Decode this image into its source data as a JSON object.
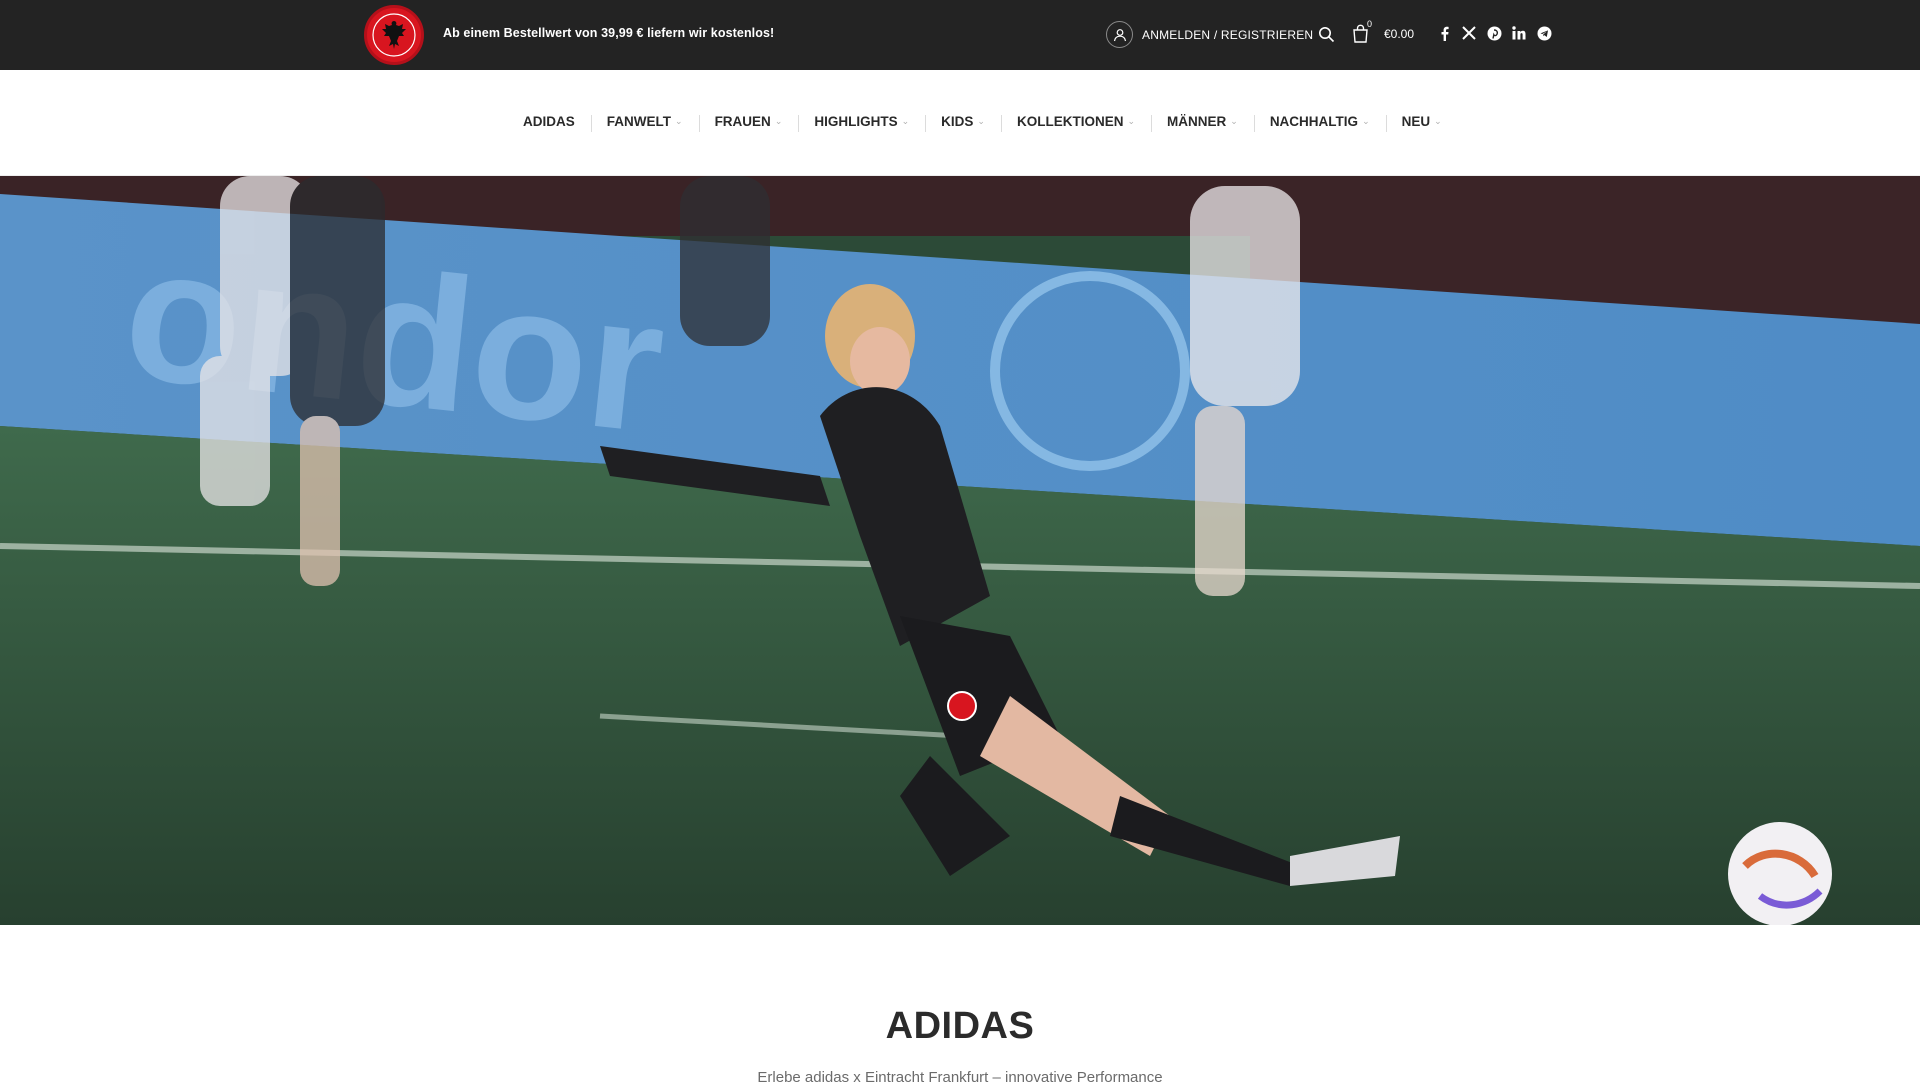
{
  "header": {
    "promo_text": "Ab einem Bestellwert von 39,99 € liefern wir kostenlos!",
    "account_label": "ANMELDEN / REGISTRIEREN",
    "cart_count": "0",
    "cart_total": "€0.00",
    "icons": {
      "logo": "eagle-logo-icon",
      "account": "user-icon",
      "search": "search-icon",
      "cart": "shopping-bag-icon",
      "social": [
        "facebook-icon",
        "x-icon",
        "pinterest-icon",
        "linkedin-icon",
        "telegram-icon"
      ]
    }
  },
  "nav": {
    "items": [
      {
        "label": "ADIDAS",
        "has_dropdown": false
      },
      {
        "label": "FANWELT",
        "has_dropdown": true
      },
      {
        "label": "FRAUEN",
        "has_dropdown": true
      },
      {
        "label": "HIGHLIGHTS",
        "has_dropdown": true
      },
      {
        "label": "KIDS",
        "has_dropdown": true
      },
      {
        "label": "KOLLEKTIONEN",
        "has_dropdown": true
      },
      {
        "label": "MÄNNER",
        "has_dropdown": true
      },
      {
        "label": "NACHHALTIG",
        "has_dropdown": true
      },
      {
        "label": "NEU",
        "has_dropdown": true
      }
    ]
  },
  "section": {
    "title": "ADIDAS",
    "subtitle": "Erlebe adidas x Eintracht Frankfurt – innovative Performance"
  },
  "colors": {
    "topbar_bg": "#232323",
    "brand_red": "#d8151f",
    "text_dark": "#2a2a2a"
  }
}
